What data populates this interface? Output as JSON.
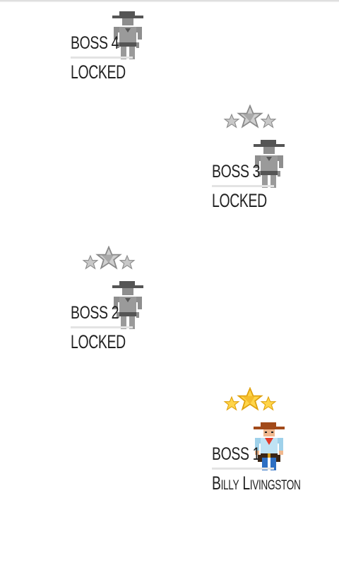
{
  "colors": {
    "locked_figure": "#8e8e8e",
    "locked_hat": "#555555",
    "locked_star_light": "#c8c8c8",
    "locked_star_dark": "#8a8a8a",
    "gold_star_light": "#ffd54a",
    "gold_star_dark": "#e0a20e",
    "cowboy_hat": "#a24a1a",
    "cowboy_skin": "#f0b88e",
    "cowboy_shirt": "#9fd1ea",
    "cowboy_pants": "#2d6fc3",
    "cowboy_belt": "#3a2616",
    "cowboy_bandana": "#e23a2a"
  },
  "bosses": [
    {
      "label": "BOSS 4",
      "status": "LOCKED",
      "locked": true,
      "stars_visible": false,
      "icon": "locked-cowboy-icon"
    },
    {
      "label": "BOSS 3",
      "status": "LOCKED",
      "locked": true,
      "stars_visible": true,
      "star_style": "grey",
      "icon": "locked-cowboy-icon"
    },
    {
      "label": "BOSS 2",
      "status": "LOCKED",
      "locked": true,
      "stars_visible": true,
      "star_style": "grey",
      "icon": "locked-cowboy-icon"
    },
    {
      "label": "BOSS 1",
      "status": "Billy Livingston",
      "locked": false,
      "stars_visible": true,
      "star_style": "gold",
      "icon": "cowboy-icon"
    }
  ]
}
